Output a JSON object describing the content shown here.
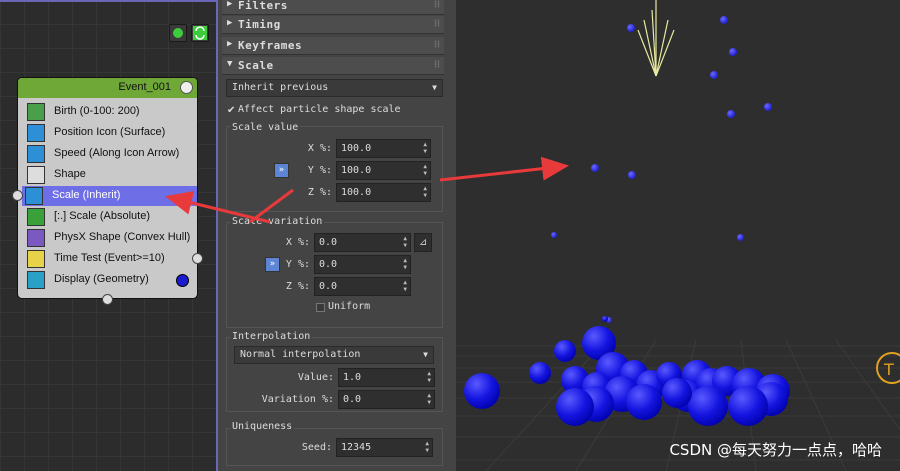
{
  "event": {
    "title": "Event_001",
    "operators": [
      {
        "label": "Birth (0-100: 200)",
        "icon": "birth-icon",
        "color": "#4aa04a"
      },
      {
        "label": "Position Icon (Surface)",
        "icon": "position-icon",
        "color": "#2d8fd6"
      },
      {
        "label": "Speed (Along Icon Arrow)",
        "icon": "speed-icon",
        "color": "#2d8fd6"
      },
      {
        "label": "Shape",
        "icon": "shape-icon",
        "color": "#dddddd"
      },
      {
        "label": "Scale (Inherit)",
        "icon": "scale-icon",
        "color": "#2d8fd6"
      },
      {
        "label": "[:.] Scale (Absolute)",
        "icon": "scale-abs-icon",
        "color": "#3aa03a"
      },
      {
        "label": "PhysX Shape (Convex Hull)",
        "icon": "physx-icon",
        "color": "#7a5ac0"
      },
      {
        "label": "Time Test (Event>=10)",
        "icon": "clock-icon",
        "color": "#e8d24a"
      },
      {
        "label": "Display (Geometry)",
        "icon": "display-icon",
        "color": "#2aa0c8"
      }
    ]
  },
  "rollouts": {
    "filters": "Filters",
    "timing": "Timing",
    "keyframes": "Keyframes",
    "scale": "Scale"
  },
  "scale": {
    "mode": "Inherit previous",
    "affect_label": "Affect particle shape scale",
    "affect_checked": true,
    "scale_value_label": "Scale value",
    "x_label": "X %:",
    "y_label": "Y %:",
    "z_label": "Z %:",
    "x_value": "100.0",
    "y_value": "100.0",
    "z_value": "100.0",
    "variation_label": "Scale variation",
    "vx": "0.0",
    "vy": "0.0",
    "vz": "0.0",
    "uniform_label": "Uniform",
    "lock_glyph": "»"
  },
  "interpolation": {
    "label": "Interpolation",
    "mode": "Normal interpolation",
    "value_label": "Value:",
    "value": "1.0",
    "variation_label": "Variation %:",
    "variation": "0.0"
  },
  "uniqueness": {
    "label": "Uniqueness",
    "seed_label": "Seed:",
    "seed": "12345"
  },
  "watermark": "CSDN @每天努力一点点，哈哈",
  "colors": {
    "selected": "#6e6ee6",
    "event_header": "#6fa837",
    "particle": "#1414e0",
    "arrow": "#e83a3a"
  }
}
